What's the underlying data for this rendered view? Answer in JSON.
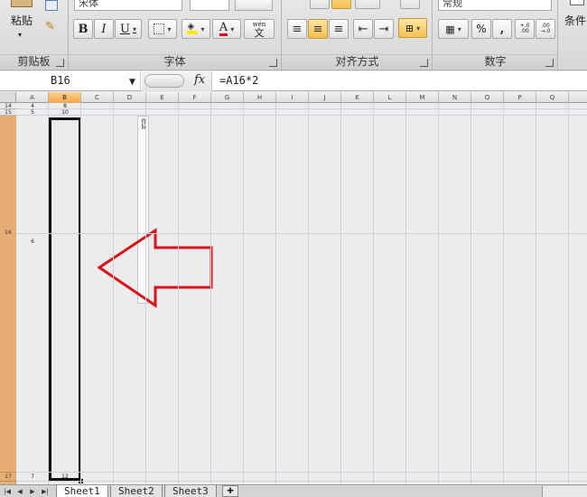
{
  "ribbon": {
    "clipboard": {
      "paste_label": "粘贴",
      "group_label": "剪贴板"
    },
    "font": {
      "font_name": "宋体",
      "bold_label": "B",
      "italic_label": "I",
      "underline_label": "U",
      "font_color_letter": "A",
      "wen_label": "wén",
      "wen_char": "文",
      "group_label": "字体"
    },
    "alignment": {
      "group_label": "对齐方式"
    },
    "number": {
      "format_value": "常规",
      "percent_label": "%",
      "comma_label": ",",
      "inc_decimal_label": "+.0 .00",
      "dec_decimal_label": ".00 →.0",
      "group_label": "数字"
    },
    "styles": {
      "conditional_label": "条件"
    }
  },
  "formula_bar": {
    "name_box": "B16",
    "fx_label": "fx",
    "formula": "=A16*2"
  },
  "columns": [
    "A",
    "B",
    "C",
    "D",
    "E",
    "F",
    "G",
    "H",
    "I",
    "J",
    "K",
    "L",
    "M",
    "N",
    "O",
    "P",
    "Q"
  ],
  "selected_column": "B",
  "rows": [
    {
      "label": "14",
      "a": "4",
      "b": "8"
    },
    {
      "label": "15",
      "a": "5",
      "b": "10"
    },
    {
      "label": "16",
      "a": "6",
      "b": ""
    },
    {
      "label": "17",
      "a": "7",
      "b": "12"
    }
  ],
  "note_cell_text": "你好",
  "annotation": {
    "arrow_color": "#d9121a"
  },
  "sheet_tabs": [
    "Sheet1",
    "Sheet2",
    "Sheet3"
  ],
  "active_sheet": "Sheet1"
}
